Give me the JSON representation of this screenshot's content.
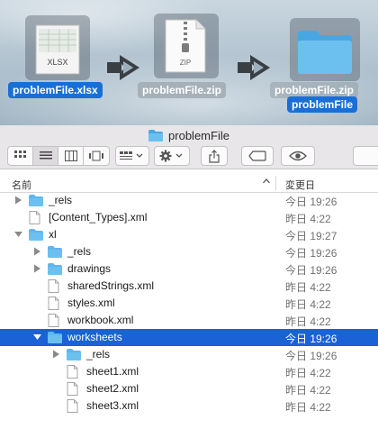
{
  "steps": {
    "xlsx_label": "problemFile.xlsx",
    "xlsx_icon_text": "XLSX",
    "zip_label": "problemFile.zip",
    "zip_icon_text": "ZIP",
    "folder_label_ghost": "problemFile.zip",
    "folder_label": "problemFile"
  },
  "window": {
    "title": "problemFile"
  },
  "toolbar": {
    "icons": [
      "icon-view-icon",
      "list-view-icon",
      "column-view-icon",
      "gallery-view-icon",
      "group-icon",
      "gear-icon",
      "share-icon",
      "tag-icon",
      "quicklook-icon"
    ]
  },
  "columns": {
    "name": "名前",
    "modified": "変更日"
  },
  "rows": [
    {
      "name": "_rels",
      "date": "今日 19:26",
      "level": 0,
      "kind": "folder",
      "expander": "collapsed",
      "selected": false
    },
    {
      "name": "[Content_Types].xml",
      "date": "昨日 4:22",
      "level": 0,
      "kind": "file",
      "expander": "none",
      "selected": false
    },
    {
      "name": "xl",
      "date": "今日 19:27",
      "level": 0,
      "kind": "folder",
      "expander": "expanded",
      "selected": false
    },
    {
      "name": "_rels",
      "date": "今日 19:26",
      "level": 1,
      "kind": "folder",
      "expander": "collapsed",
      "selected": false
    },
    {
      "name": "drawings",
      "date": "今日 19:26",
      "level": 1,
      "kind": "folder",
      "expander": "collapsed",
      "selected": false
    },
    {
      "name": "sharedStrings.xml",
      "date": "昨日 4:22",
      "level": 1,
      "kind": "file",
      "expander": "none",
      "selected": false
    },
    {
      "name": "styles.xml",
      "date": "昨日 4:22",
      "level": 1,
      "kind": "file",
      "expander": "none",
      "selected": false
    },
    {
      "name": "workbook.xml",
      "date": "昨日 4:22",
      "level": 1,
      "kind": "file",
      "expander": "none",
      "selected": false
    },
    {
      "name": "worksheets",
      "date": "今日 19:26",
      "level": 1,
      "kind": "folder",
      "expander": "expanded",
      "selected": true
    },
    {
      "name": "_rels",
      "date": "今日 19:26",
      "level": 2,
      "kind": "folder",
      "expander": "collapsed",
      "selected": false
    },
    {
      "name": "sheet1.xml",
      "date": "昨日 4:22",
      "level": 2,
      "kind": "file",
      "expander": "none",
      "selected": false
    },
    {
      "name": "sheet2.xml",
      "date": "昨日 4:22",
      "level": 2,
      "kind": "file",
      "expander": "none",
      "selected": false
    },
    {
      "name": "sheet3.xml",
      "date": "昨日 4:22",
      "level": 2,
      "kind": "file",
      "expander": "none",
      "selected": false
    }
  ],
  "colors": {
    "selection": "#1a62d6",
    "folder": "#5fb6ec",
    "label": "#1a6fd6"
  }
}
